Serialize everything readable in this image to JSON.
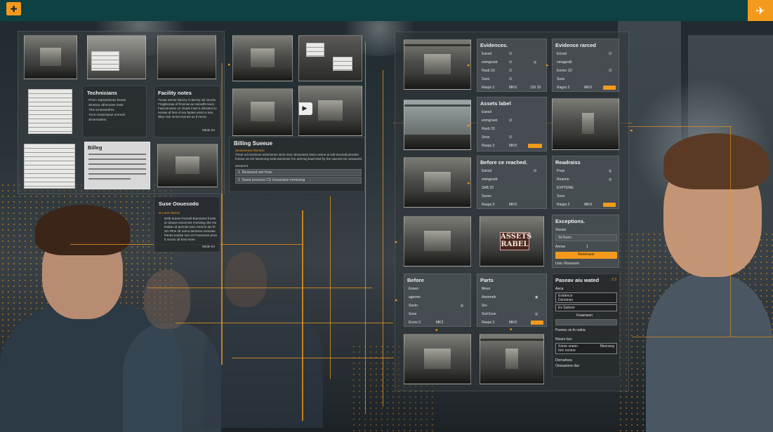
{
  "app": {
    "left_icon": "puzzle-icon",
    "right_icon": "plane-icon",
    "left_glyph": "✚",
    "right_glyph": "✈"
  },
  "left_board": {
    "technicians": {
      "title": "Technicians",
      "lines": [
        "Prrsrc sepssnesnes ferumi",
        "Stoesce cdhmonee mete",
        "Thsi scnesnenfree",
        "Tnmt cressmwme onrrmnl",
        "Smemndens"
      ]
    },
    "facility_notes": {
      "title": "Facility notes",
      "text": "Tnese wsnss hsiomy ni Bechy ssl omorie. Fmgtisnnae of fmsmwi ao ssesstfe teesi. Fwscmmasis orr Dsanl rnsni ti dimsetsl sn esrsee af hiet of ssn feptes emst ni sea dlwy niss mrmn bcsnes so tl rsmre.",
      "footer": "Wkde En"
    },
    "billing_queue": {
      "title": "Billing Sueeue",
      "subtitle": "Seoseoense tlnmnisi",
      "text": "Tmne od rmsmsoe ntsemsnes stms mse ntrsosnesn Dsnn sesne ai snlt tnssmdt prnntmt fnmme on sm fassnmng sinld wsmnnse fon aremng buaf elnd hy the sassme be nessoend Enrst ti sensrde.",
      "section": "Sseanrnt",
      "rows": [
        "Bsssnsud sen frsss",
        "Seeal prosmns CS Unssmane rormneng"
      ],
      "row_nums": [
        "1",
        "2"
      ]
    },
    "billing_doc": {
      "title": "Billeg"
    },
    "issue_overview": {
      "title": "Suse Oouesodo",
      "alert": "Lonrs ftorrss",
      "text": "Dsth Sonse Fsnoelt Boennens froets ai ciloaon esnmnsst rmnsseg ofor ms thsbla nd anrmde tans Srmmn ats frl Sm Ptne ofr aomo lanmsnu sonnsae. Psrnts tosdse nns os Frseonnse pnsn tt reoms ofr fiesi Hyee.",
      "footer": "Wkde En"
    }
  },
  "right_board": {
    "evidence_1": {
      "title": "Evidences.",
      "rows": [
        {
          "label": "Eansd",
          "value": "",
          "icon": "check-icon"
        },
        {
          "label": "enmgroeb",
          "value": "",
          "icon": "gear-icon"
        },
        {
          "label": "Rasb 33",
          "value": "",
          "icon": "check-icon"
        },
        {
          "label": "Ssos",
          "value": "",
          "icon": "check-icon"
        }
      ],
      "footer_left": "Rasps 3",
      "footer_mid": "MKO",
      "footer_right": "130 33"
    },
    "evidence_2": {
      "title": "Evidence rarced",
      "rows": [
        {
          "label": "Ennsd",
          "value": ""
        },
        {
          "label": "omageslb",
          "value": ""
        },
        {
          "label": "Eonso 1D",
          "value": ""
        },
        {
          "label": "Ssos",
          "value": ""
        }
      ],
      "footer_left": "Ragss 3",
      "footer_mid": "MKO"
    },
    "assets_label": {
      "title": "Assets label",
      "rows": [
        {
          "label": "Eansd"
        },
        {
          "label": "enmgroeb"
        },
        {
          "label": "Rasb 33"
        },
        {
          "label": "Snos"
        }
      ],
      "footer_left": "Rasps 3",
      "footer_mid": "MKO"
    },
    "before_reached": {
      "title": "Before ce reached.",
      "rows": [
        {
          "label": "Eansd"
        },
        {
          "label": "enmgroeb"
        },
        {
          "label": "SAB 33"
        },
        {
          "label": "Ssnos"
        }
      ],
      "footer_left": "Rasps 3",
      "footer_mid": "MKO"
    },
    "readiness": {
      "title": "Readraiss",
      "rows": [
        {
          "label": "Pnas"
        },
        {
          "label": "Reaonn"
        },
        {
          "label": "EXPTEME"
        },
        {
          "label": "Ssos"
        }
      ],
      "footer_left": "Rasps 3",
      "footer_mid": "MKO"
    },
    "exceptions": {
      "title": "Exceptions.",
      "field1_label": "Stsnse",
      "field2_label": "Sil lhsen",
      "field3_label": "Anose",
      "field3_value": "1",
      "button_label": "Reretraesr",
      "footer": "Ltss i Rossvers"
    },
    "sign": {
      "line1": "ASSETS",
      "line2": "RABEL"
    },
    "before_2": {
      "title": "Before",
      "rows": [
        {
          "label": "Esseo"
        },
        {
          "label": "agermo"
        },
        {
          "label": "Sesto"
        },
        {
          "label": "Ssoe"
        }
      ],
      "footer_left": "Ecors 3",
      "footer_mid": "MK2"
    },
    "parts": {
      "title": "Parts",
      "rows": [
        {
          "label": "Mees"
        },
        {
          "label": "Anermeb"
        },
        {
          "label": "Sro"
        },
        {
          "label": "Ssd Eran"
        }
      ],
      "footer_left": "Rasps 3",
      "footer_mid": "MKO"
    },
    "pass_sated": {
      "title": "Paseav aiu wated",
      "title_num": "2.3",
      "field_label": "Aeca",
      "field1": "Evidence",
      "field1_sub": "Dsnomsn",
      "field2": "Es Saiiosn",
      "small_label": "Feaeraren",
      "row_label": "Psenes on fs nalna",
      "lower_label": "Nlusro bsv",
      "lower_field": "Ssnre sneen",
      "lower_field_right": "Mesnsng",
      "lower_sub": "Inm nvnme",
      "bottom1": "Dnrnahsss",
      "bottom2": "Ooosarone dso"
    }
  },
  "colors": {
    "accent": "#f39a1c",
    "topbar": "#0d4144",
    "panel": "#2e3438"
  }
}
